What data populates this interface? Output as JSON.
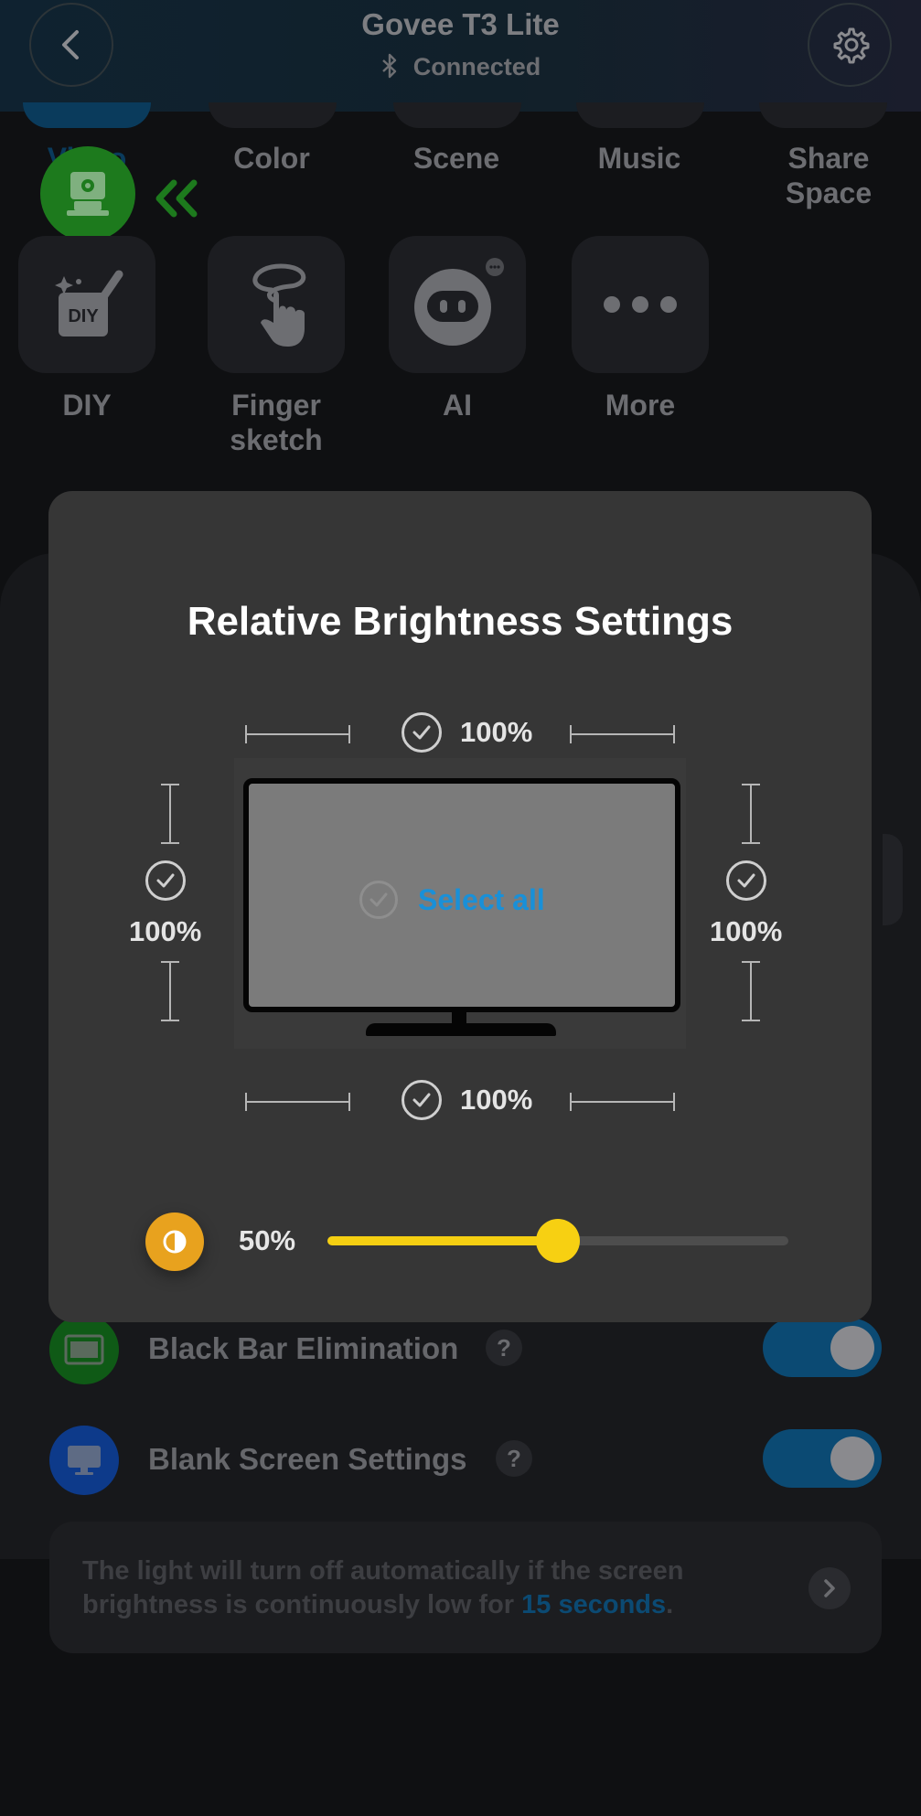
{
  "header": {
    "title": "Govee T3 Lite",
    "status": "Connected",
    "back_icon": "back-arrow-icon",
    "settings_icon": "gear-icon"
  },
  "tabs": [
    {
      "label": "Video",
      "icon": "projector-icon"
    },
    {
      "label": "Color"
    },
    {
      "label": "Scene"
    },
    {
      "label": "Music"
    },
    {
      "label": "Share Space"
    }
  ],
  "features": [
    {
      "label": "DIY",
      "icon": "diy-icon"
    },
    {
      "label": "Finger sketch",
      "icon": "finger-sketch-icon"
    },
    {
      "label": "AI",
      "icon": "ai-robot-icon"
    },
    {
      "label": "More",
      "icon": "more-dots-icon"
    }
  ],
  "modal": {
    "title": "Relative Brightness Settings",
    "top_value": "100%",
    "left_value": "100%",
    "right_value": "100%",
    "bottom_value": "100%",
    "select_all_label": "Select all",
    "brightness": {
      "label": "50%",
      "level": 0.5
    }
  },
  "settings": [
    {
      "label": "Black Bar Elimination",
      "help": "?",
      "enabled": true,
      "icon_color": "#0f5a16"
    },
    {
      "label": "Blank Screen Settings",
      "help": "?",
      "enabled": true,
      "icon_color": "#0d3a8a"
    }
  ],
  "info": {
    "text_before": "The light will turn off automatically if the screen brightness is continuously low for ",
    "highlight": "15 seconds",
    "text_after": "."
  },
  "colors": {
    "accent_blue": "#1990d8",
    "slider_yellow": "#f5cf12",
    "brightness_icon": "#e8a21e",
    "active_tab_green": "#1d7a1d"
  }
}
